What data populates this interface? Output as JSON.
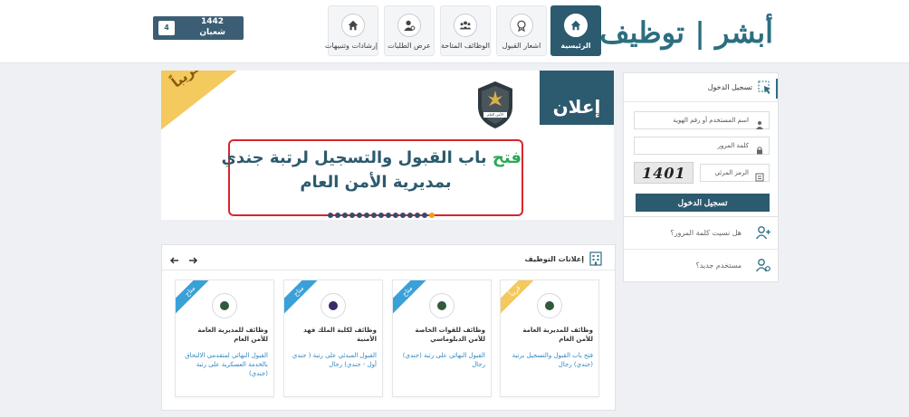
{
  "header": {
    "logo_text": "أبشر | توظيف",
    "date": {
      "year": "1442",
      "month": "شعبان",
      "day": "4"
    },
    "nav": [
      {
        "label": "الرئيسية",
        "icon": "home-icon",
        "active": true
      },
      {
        "label": "اشعار القبول",
        "icon": "certificate-icon",
        "active": false
      },
      {
        "label": "الوظائف المتاحة",
        "icon": "people-icon",
        "active": false
      },
      {
        "label": "عرض الطلبات",
        "icon": "user-gear-icon",
        "active": false
      },
      {
        "label": "إرشادات وتنبيهات",
        "icon": "home-icon",
        "active": false
      }
    ]
  },
  "login": {
    "title": "تسجيل الدخول",
    "username_placeholder": "اسم المستخدم أو رقم الهوية",
    "password_placeholder": "كلمة المرور",
    "captcha_placeholder": "الرمز المرئي",
    "captcha_text": "1401",
    "submit_label": "تسجيل الدخول",
    "forgot_password": "هل نسيت كلمة المرور؟",
    "new_user": "مستخدم جديد؟"
  },
  "banner": {
    "ribbon_text": "قريباً",
    "badge_text": "إعلان",
    "emblem_caption": "الأمن العام",
    "headline_highlight": "فتح",
    "headline_line1_rest": "باب القبول والتسجيل لرتبة جندي",
    "headline_line2": "بمديرية الأمن العام",
    "slides_total": 15,
    "slide_current": 15
  },
  "jobs": {
    "title": "إعلانات التوظيف",
    "cards": [
      {
        "tag": "قريباً",
        "tag_color": "#f4c95d",
        "title": "وظائف للمديرية العامة للأمن العام",
        "desc": "فتح باب القبول والتسجيل برتبة (جندي) رجال"
      },
      {
        "tag": "متاح",
        "tag_color": "#3aa0d8",
        "title": "وظائف للقوات الخاصة للأمن الدبلوماسي",
        "desc": "القبول النهائي على رتبة (جندي) رجال"
      },
      {
        "tag": "متاح",
        "tag_color": "#3aa0d8",
        "title": "وظائف لكلية الملك فهد الأمنية",
        "desc": "القبول المبدئي على رتبة ( جندي أول - جندي) رجال"
      },
      {
        "tag": "متاح",
        "tag_color": "#3aa0d8",
        "title": "وظائف للمديرية العامة للأمن العام",
        "desc": "القبول النهائي لمتقدمي الالتحاق بالخدمة العسكرية على رتبة (جندي)"
      }
    ]
  },
  "colors": {
    "primary": "#2c5a6e",
    "accent": "#2aa856",
    "alert": "#d9252e",
    "coming_soon": "#f4c95d",
    "available": "#3aa0d8"
  }
}
